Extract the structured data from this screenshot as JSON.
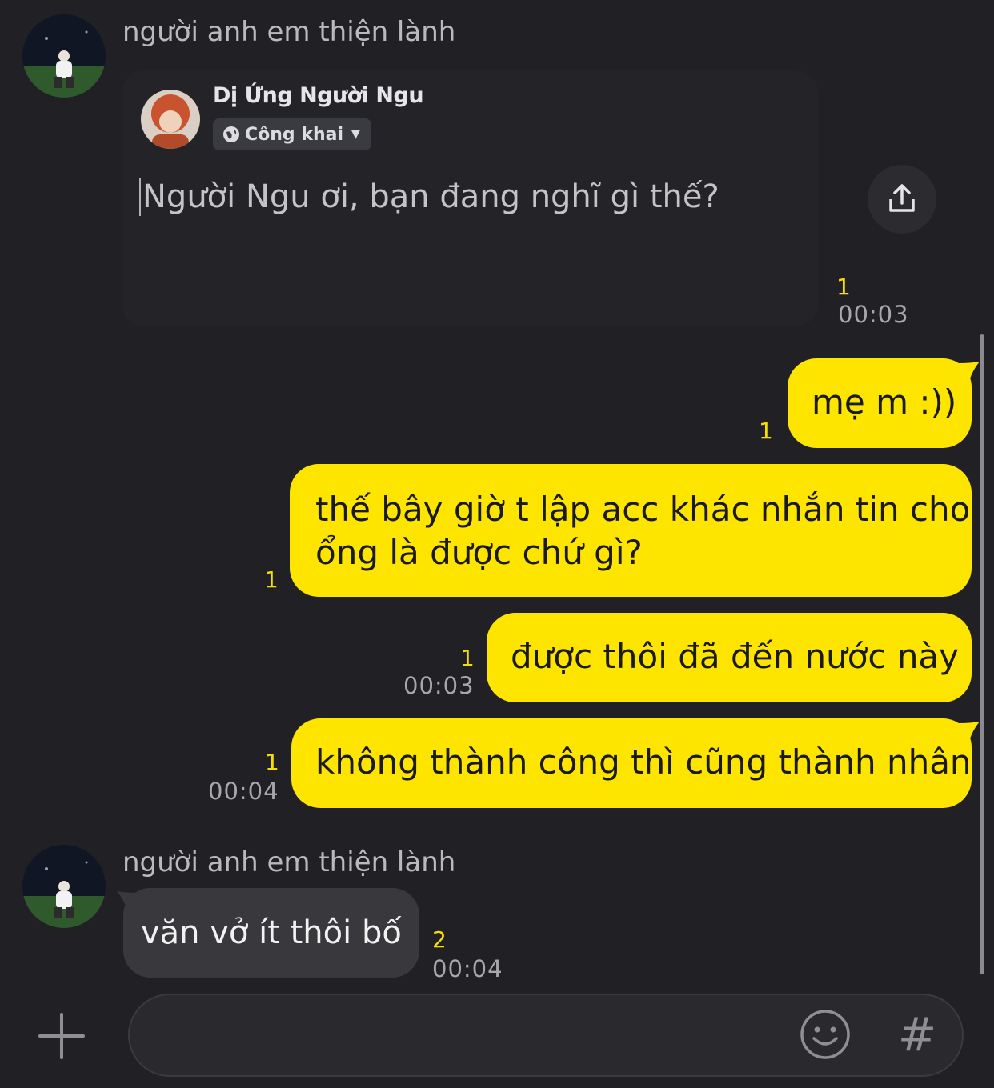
{
  "messages": {
    "first_sender": {
      "name": "người anh em thiện lành"
    },
    "shared_post": {
      "author": "Dị Ứng Người Ngu",
      "privacy": "Công khai",
      "composer_text": "Người Ngu ơi, bạn đang nghĩ gì thế?",
      "read_count": "1",
      "time": "00:03"
    },
    "outgoing": [
      {
        "text": "mẹ m :))",
        "read_count": "1",
        "time": ""
      },
      {
        "text_line1": "thế bây giờ t lập acc khác nhắn tin cho",
        "text_line2": "ổng là được chứ gì?",
        "read_count": "1",
        "time": ""
      },
      {
        "text": "được thôi đã đến nước này",
        "read_count": "1",
        "time": "00:03"
      },
      {
        "text": "không thành công thì cũng thành nhân",
        "read_count": "1",
        "time": "00:04"
      }
    ],
    "second_sender": {
      "name": "người anh em thiện lành"
    },
    "incoming": {
      "text": "văn vở ít thôi bố",
      "read_count": "2",
      "time": "00:04"
    }
  },
  "input_bar": {
    "add_icon": "plus-icon",
    "emoji_icon": "smiley-icon",
    "hashtag_label": "#",
    "message_value": ""
  },
  "colors": {
    "background": "#212125",
    "outgoing_bubble": "#fee500",
    "incoming_bubble": "#38383d",
    "read_count": "#f5e000"
  }
}
